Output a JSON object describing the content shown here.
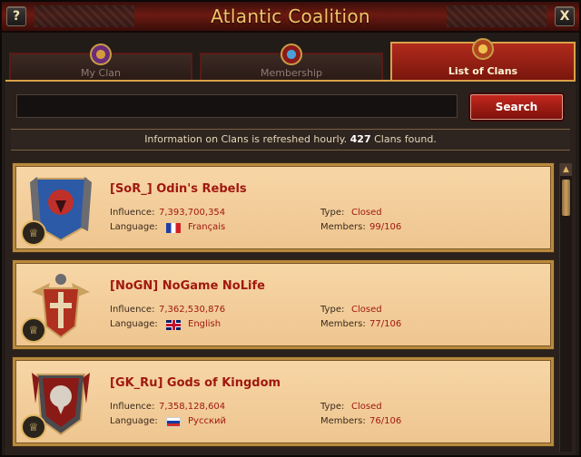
{
  "window": {
    "title": "Atlantic Coalition",
    "help_label": "?",
    "close_label": "X"
  },
  "tabs": [
    {
      "label": "My Clan",
      "icon": "clan-shield-icon"
    },
    {
      "label": "Membership",
      "icon": "membership-banner-icon"
    },
    {
      "label": "List of Clans",
      "icon": "clan-list-icon",
      "active": true
    }
  ],
  "search": {
    "value": "",
    "placeholder": "",
    "button_label": "Search"
  },
  "info": {
    "prefix": "Information on Clans is refreshed hourly.",
    "count": "427",
    "suffix": "Clans found."
  },
  "labels": {
    "influence": "Influence:",
    "language": "Language:",
    "type": "Type:",
    "members": "Members:"
  },
  "clans": [
    {
      "name": "[SoR_] Odin's Rebels",
      "influence": "7,393,700,354",
      "language": "Français",
      "flag": "fr",
      "type": "Closed",
      "members": "99/106",
      "crest_color": "#2c5aa6"
    },
    {
      "name": "[NoGN] NoGame NoLife",
      "influence": "7,362,530,876",
      "language": "English",
      "flag": "gb",
      "type": "Closed",
      "members": "77/106",
      "crest_color": "#b03020"
    },
    {
      "name": "[GK_Ru] Gods of Kingdom",
      "influence": "7,358,128,604",
      "language": "Русский",
      "flag": "ru",
      "type": "Closed",
      "members": "76/106",
      "crest_color": "#5a5a5a"
    }
  ],
  "colors": {
    "accent_red": "#a0180f",
    "gold": "#d8a24a",
    "card_bg": "#f7d6a6"
  }
}
